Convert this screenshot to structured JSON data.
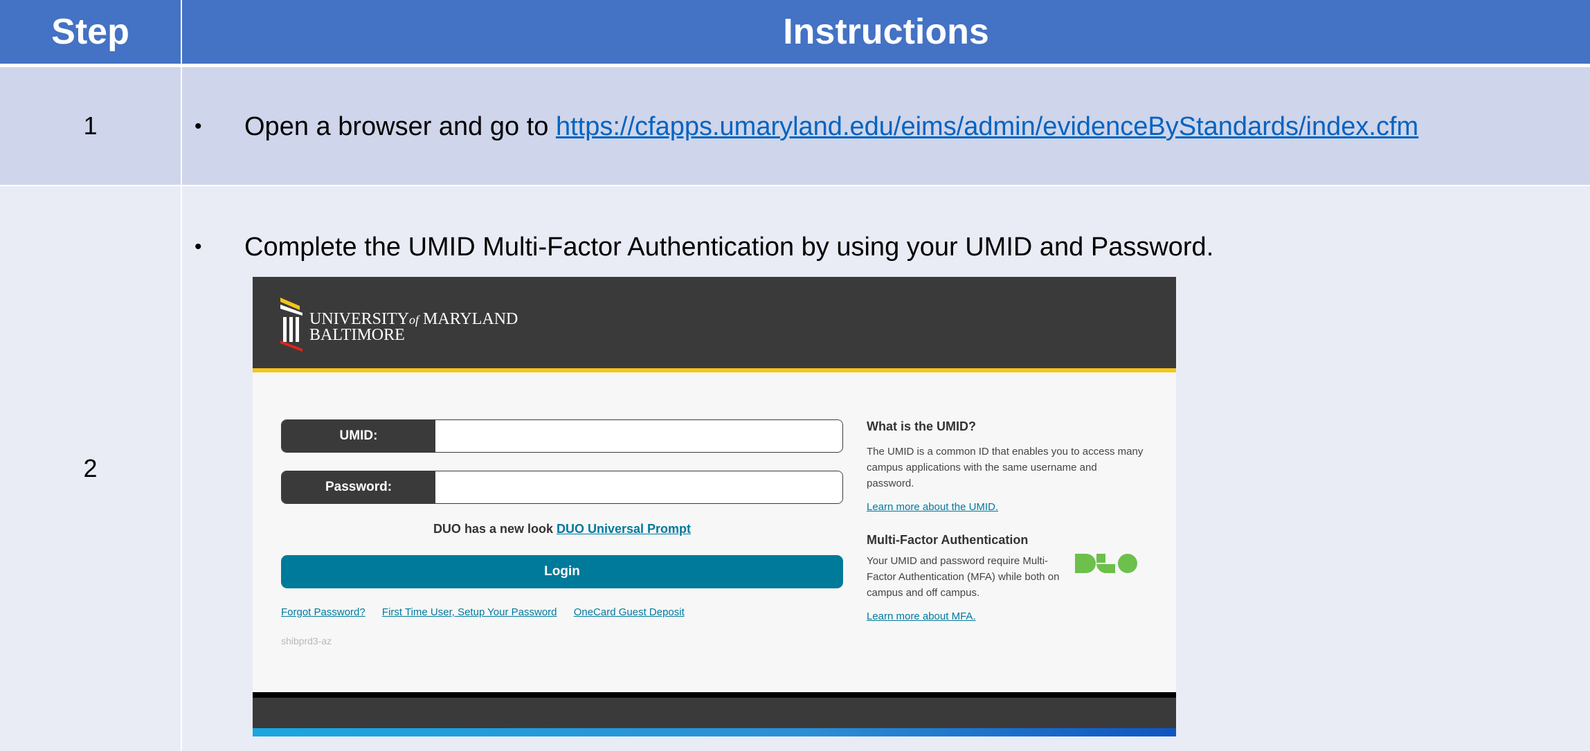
{
  "table": {
    "headers": {
      "step": "Step",
      "instructions": "Instructions"
    },
    "rows": [
      {
        "step": "1",
        "bullet": "•",
        "text": "Open a browser and go to ",
        "link": "https://cfapps.umaryland.edu/eims/admin/evidenceByStandards/index.cfm"
      },
      {
        "step": "2",
        "bullet": "•",
        "text": "Complete the UMID Multi-Factor Authentication by using your UMID and Password."
      }
    ]
  },
  "login_screenshot": {
    "logo": {
      "line1_a": "UNIVERSITY",
      "line1_of": "of",
      "line1_b": "MARYLAND",
      "line2": "BALTIMORE"
    },
    "umid_label": "UMID:",
    "password_label": "Password:",
    "duo_notice": "DUO has a new look",
    "duo_notice_link": "DUO Universal Prompt",
    "login_button": "Login",
    "footer_links": [
      "Forgot Password?",
      "First Time User, Setup Your Password",
      "OneCard Guest Deposit"
    ],
    "server_id": "shibprd3-az",
    "side": {
      "umid_heading": "What is the UMID?",
      "umid_text": "The UMID is a common ID that enables you to access many campus applications with the same username and password.",
      "umid_link": "Learn more about the UMID.",
      "mfa_heading": "Multi-Factor Authentication",
      "mfa_text": "Your UMID and password require Multi-Factor Authentication (MFA) while both on campus and off campus.",
      "mfa_link": "Learn more about MFA.",
      "duo_logo": "DUO"
    }
  },
  "colors": {
    "header_blue": "#4472c4",
    "row1_bg": "#cfd5ea",
    "row2_bg": "#e9ebf5",
    "umb_dark": "#3b3a3a",
    "umb_teal": "#007a9a",
    "umb_yellow": "#f5c518",
    "duo_green": "#6dc04b"
  }
}
